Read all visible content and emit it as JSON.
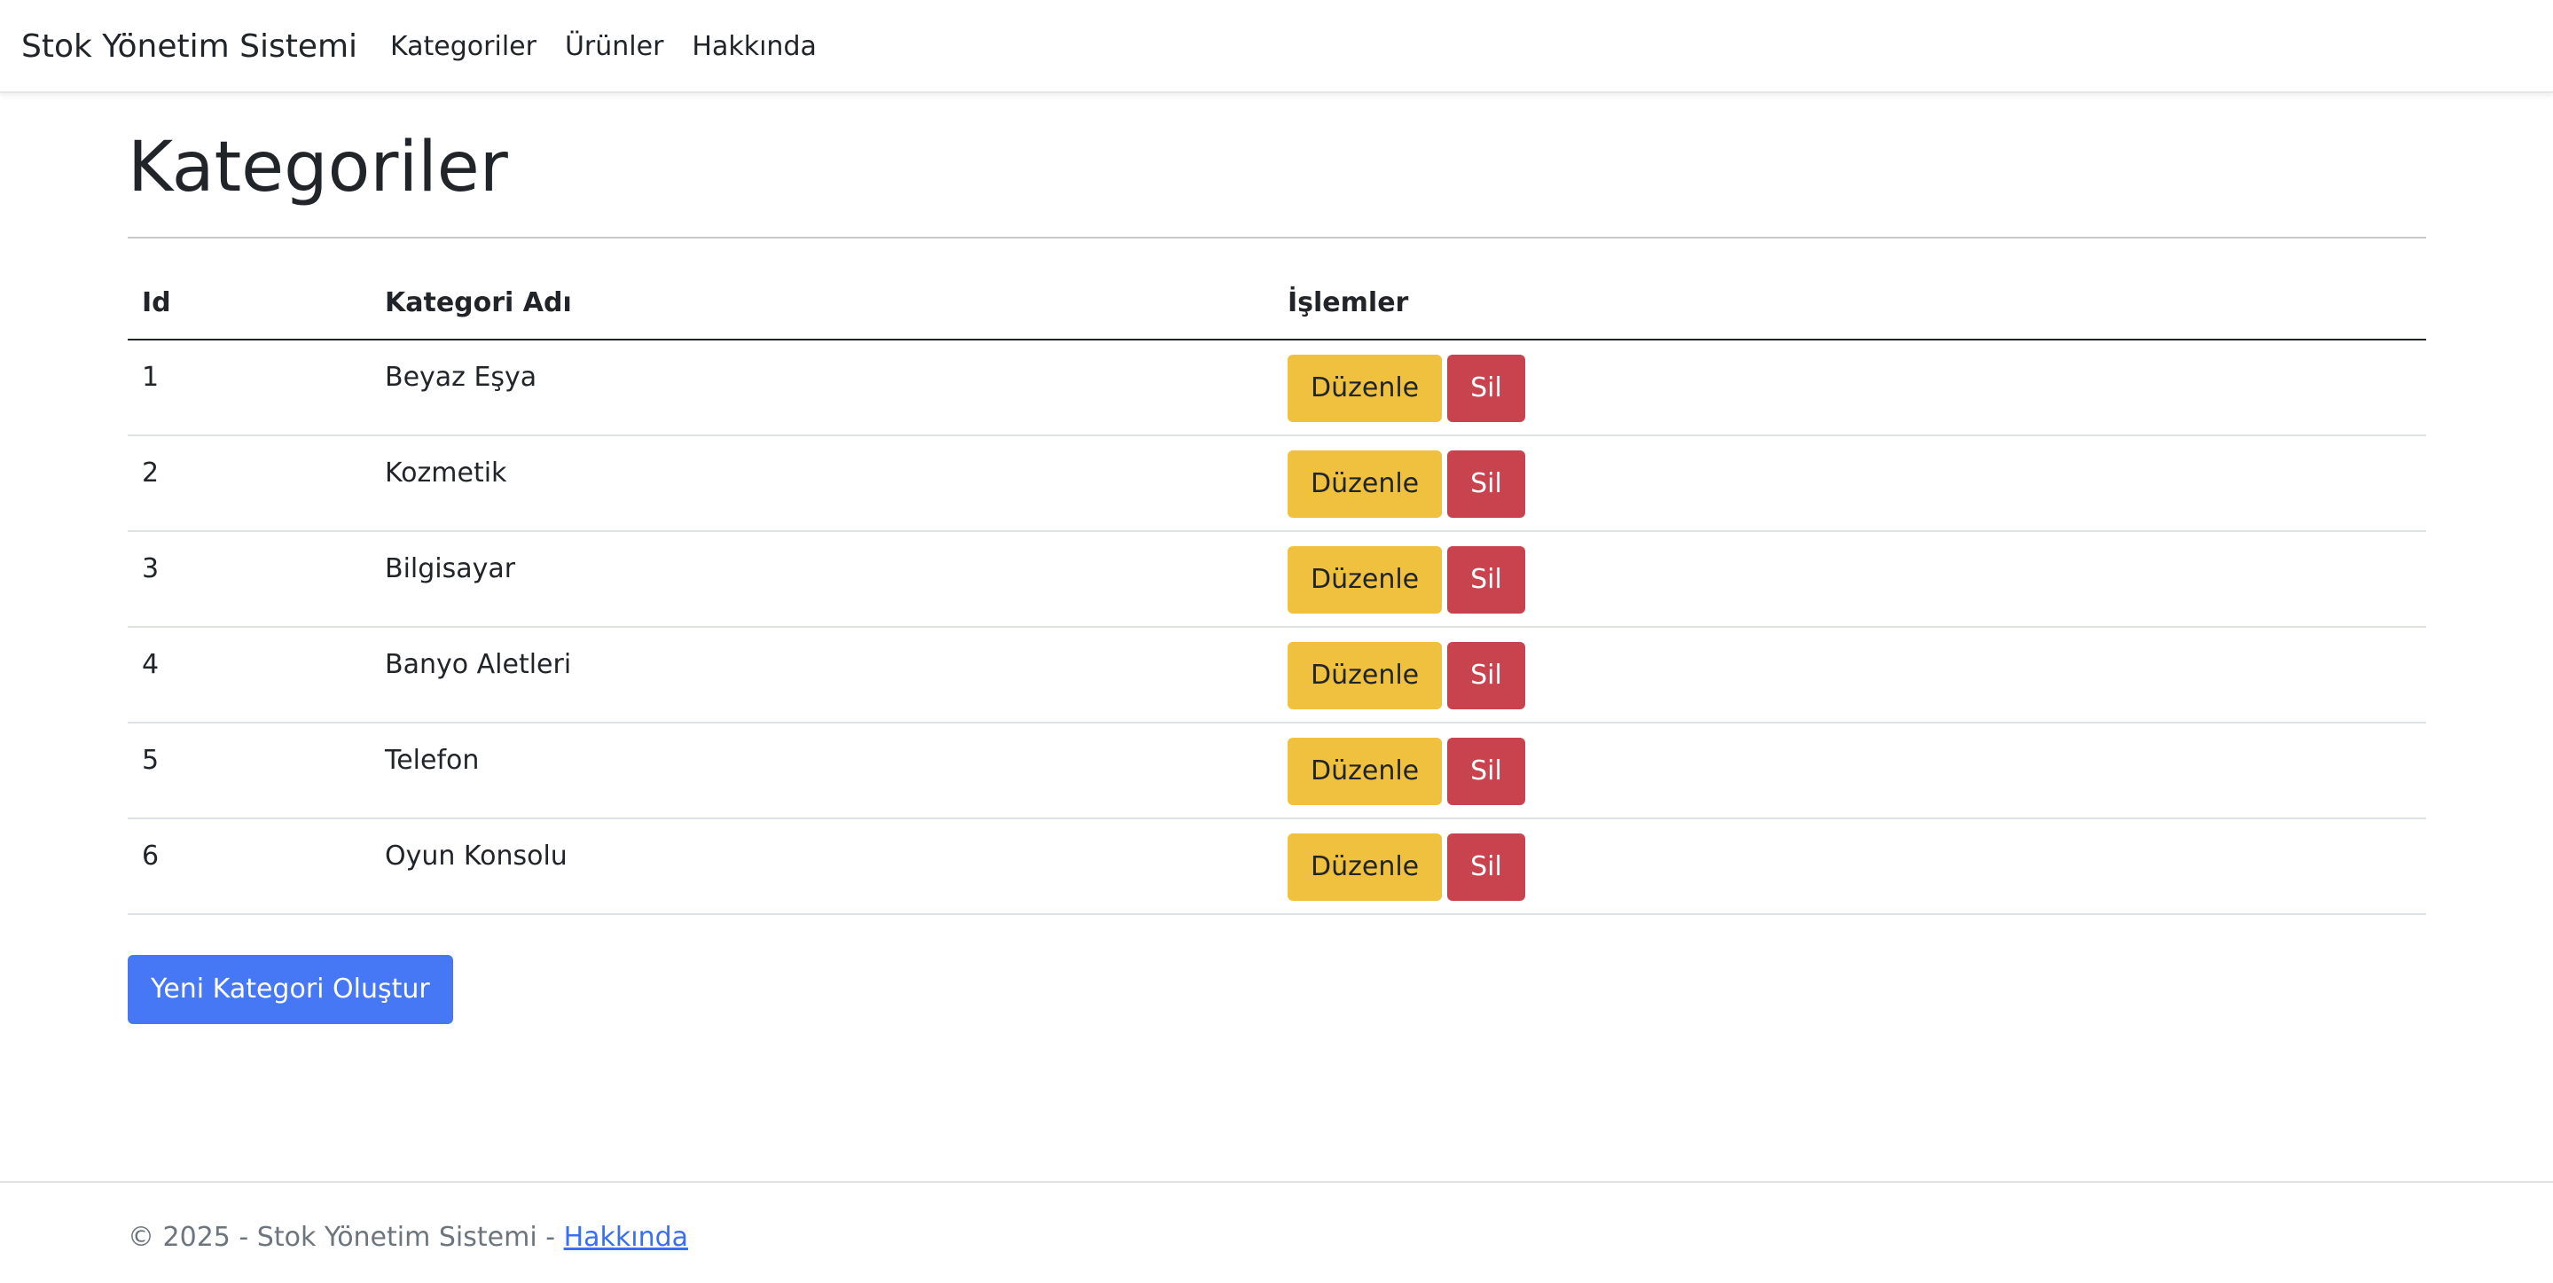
{
  "navbar": {
    "brand": "Stok Yönetim Sistemi",
    "links": [
      "Kategoriler",
      "Ürünler",
      "Hakkında"
    ]
  },
  "page": {
    "title": "Kategoriler"
  },
  "table": {
    "headers": {
      "id": "Id",
      "name": "Kategori Adı",
      "actions": "İşlemler"
    },
    "rows": [
      {
        "id": "1",
        "name": "Beyaz Eşya"
      },
      {
        "id": "2",
        "name": "Kozmetik"
      },
      {
        "id": "3",
        "name": "Bilgisayar"
      },
      {
        "id": "4",
        "name": "Banyo Aletleri"
      },
      {
        "id": "5",
        "name": "Telefon"
      },
      {
        "id": "6",
        "name": "Oyun Konsolu"
      }
    ],
    "edit_label": "Düzenle",
    "delete_label": "Sil"
  },
  "actions": {
    "new_category_label": "Yeni Kategori Oluştur"
  },
  "footer": {
    "text": "© 2025 - Stok Yönetim Sistemi - ",
    "link_label": "Hakkında"
  },
  "colors": {
    "edit_button": "#f0c13f",
    "delete_button": "#c9434f",
    "primary_button": "#4677f5",
    "link": "#3b6ff2"
  }
}
